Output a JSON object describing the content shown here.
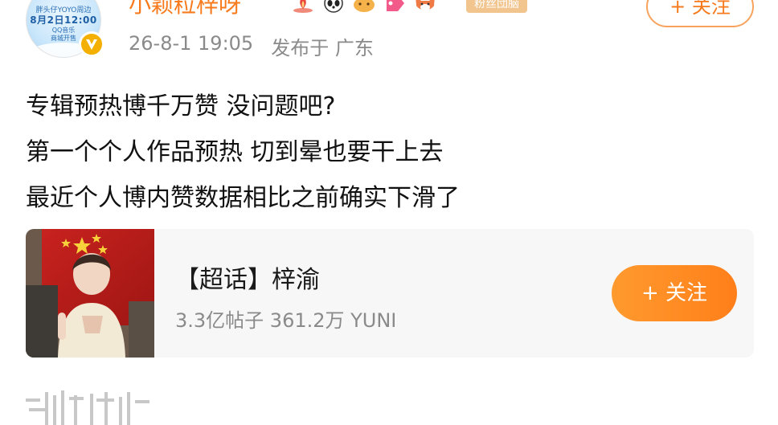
{
  "post": {
    "avatar": {
      "line1": "胖头仔YOYO周边",
      "line2": "8月2日12:00",
      "line3": "QQ音乐",
      "line4": "商城开售"
    },
    "username": "小颖粒梓呀",
    "fan_tag": "粉丝団脑",
    "follow_label": "+ 关注",
    "time": "26-8-1 19:05",
    "location": "发布于 广东",
    "lines": [
      "专辑预热博千万赞 没问题吧?",
      "第一个个人作品预热 切到晕也要干上去",
      "最近个人博内赞数据相比之前确实下滑了"
    ]
  },
  "topic": {
    "title": "【超话】梓渝",
    "stats": "3.3亿帖子 361.2万 YUNI",
    "follow_label": "+ 关注"
  },
  "colors": {
    "accent": "#f77b1d",
    "follow_bg": "#ff8c23",
    "card_bg": "#f7f7f7",
    "meta_text": "#8a8a8a"
  },
  "icons": [
    "vip-badge-icon",
    "fire-badge-icon",
    "panda-badge-icon",
    "cat-badge-icon",
    "tag-badge-icon",
    "fox-badge-icon"
  ]
}
